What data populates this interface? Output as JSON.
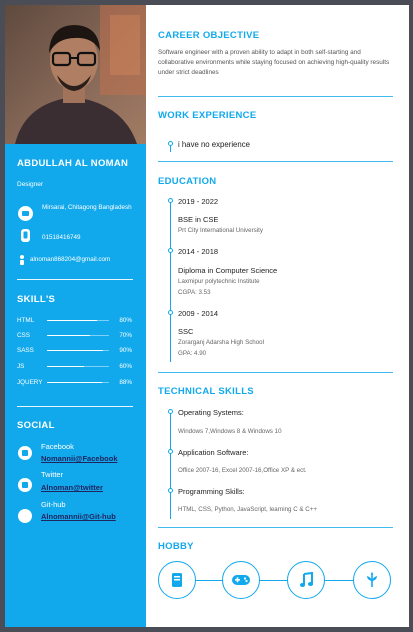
{
  "profile": {
    "name": "ABDULLAH AL NOMAN",
    "role": "Designer",
    "address": "Mirsarai, Chitagong Bangladesh",
    "phone": "01518416749",
    "email": "alnoman868204@gmail.com"
  },
  "skills": {
    "title": "SKILL'S",
    "items": [
      {
        "name": "HTML",
        "pct_label": "80%",
        "level": 0.8
      },
      {
        "name": "CSS",
        "pct_label": "70%",
        "level": 0.7
      },
      {
        "name": "SASS",
        "pct_label": "90%",
        "level": 0.9
      },
      {
        "name": "JS",
        "pct_label": "60%",
        "level": 0.6
      },
      {
        "name": "JQUERY",
        "pct_label": "88%",
        "level": 0.88
      }
    ]
  },
  "social": {
    "title": "SOCIAL",
    "items": [
      {
        "label": "Facebook",
        "link": "Nomannii@Facebook",
        "icon": "facebook-icon"
      },
      {
        "label": "Twitter",
        "link": "Alnoman@twitter",
        "icon": "twitter-icon"
      },
      {
        "label": "Git-hub",
        "link": "Alnomannii@Git-hub",
        "icon": "github-icon"
      }
    ]
  },
  "career": {
    "title": "CAREER OBJECTIVE",
    "text": "Software engineer with a proven ability to adapt in both self-starting and collaborative environments while staying focused on achieving high-quality results under strict deadlines"
  },
  "experience": {
    "title": "WORK EXPERIENCE",
    "text": "i have no experience"
  },
  "education": {
    "title": "EDUCATION",
    "items": [
      {
        "years": "2019 - 2022",
        "degree": "BSE in CSE",
        "school": "Prt City International University",
        "gpa": ""
      },
      {
        "years": "2014 - 2018",
        "degree": "Diploma in Computer Science",
        "school": "Laxmipur polytechnic Institute",
        "gpa": "CGPA: 3.53"
      },
      {
        "years": "2009 - 2014",
        "degree": "SSC",
        "school": "Zorarganj Adarsha High School",
        "gpa": "GPA: 4.90"
      }
    ]
  },
  "technical": {
    "title": "TECHNICAL SKILLS",
    "items": [
      {
        "head": "Operating Systems:",
        "detail": "Windows 7,Windows 8 & Windows 10"
      },
      {
        "head": "Application Software:",
        "detail": "Office 2007-16, Excel 2007-16,Office XP & ect."
      },
      {
        "head": "Programming Skills:",
        "detail": "HTML, CSS, Python, JavaScript, learning C & C++"
      }
    ]
  },
  "hobby": {
    "title": "HOBBY",
    "icons": [
      "book-icon",
      "gamepad-icon",
      "music-note-icon",
      "leaf-icon"
    ]
  },
  "colors": {
    "accent": "#11a9ec",
    "link": "#20255f",
    "backdrop": "#4a4d55"
  }
}
